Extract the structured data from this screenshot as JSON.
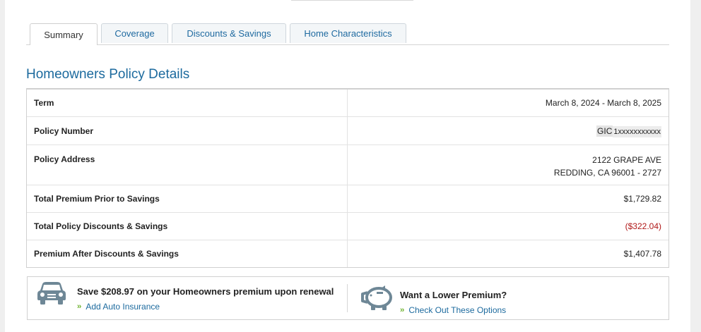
{
  "tabs": [
    {
      "label": "Summary",
      "active": true
    },
    {
      "label": "Coverage",
      "active": false
    },
    {
      "label": "Discounts & Savings",
      "active": false
    },
    {
      "label": "Home Characteristics",
      "active": false
    }
  ],
  "page_title": "Homeowners Policy Details",
  "details": {
    "term": {
      "label": "Term",
      "value": "March 8, 2024 - March 8, 2025"
    },
    "policy_number": {
      "label": "Policy Number",
      "prefix": "GIC",
      "masked": "1xxxxxxxxxxx"
    },
    "address": {
      "label": "Policy Address",
      "line1": "2122 GRAPE AVE",
      "line2": "REDDING, CA 96001 - 2727"
    },
    "premium_prior": {
      "label": "Total Premium Prior to Savings",
      "value": "$1,729.82"
    },
    "discounts": {
      "label": "Total Policy Discounts & Savings",
      "value": "($322.04)"
    },
    "premium_after": {
      "label": "Premium After Discounts & Savings",
      "value": "$1,407.78"
    }
  },
  "promo": {
    "left": {
      "icon": "car-icon",
      "heading": "Save $208.97 on your Homeowners premium upon renewal",
      "link": "Add Auto Insurance"
    },
    "right": {
      "icon": "piggy-bank-icon",
      "heading": "Want a Lower Premium?",
      "link": "Check Out These Options"
    }
  },
  "colors": {
    "link": "#1c6a9e",
    "negative": "#b01818",
    "chevron": "#6bb12d",
    "icon": "#6e8796"
  }
}
